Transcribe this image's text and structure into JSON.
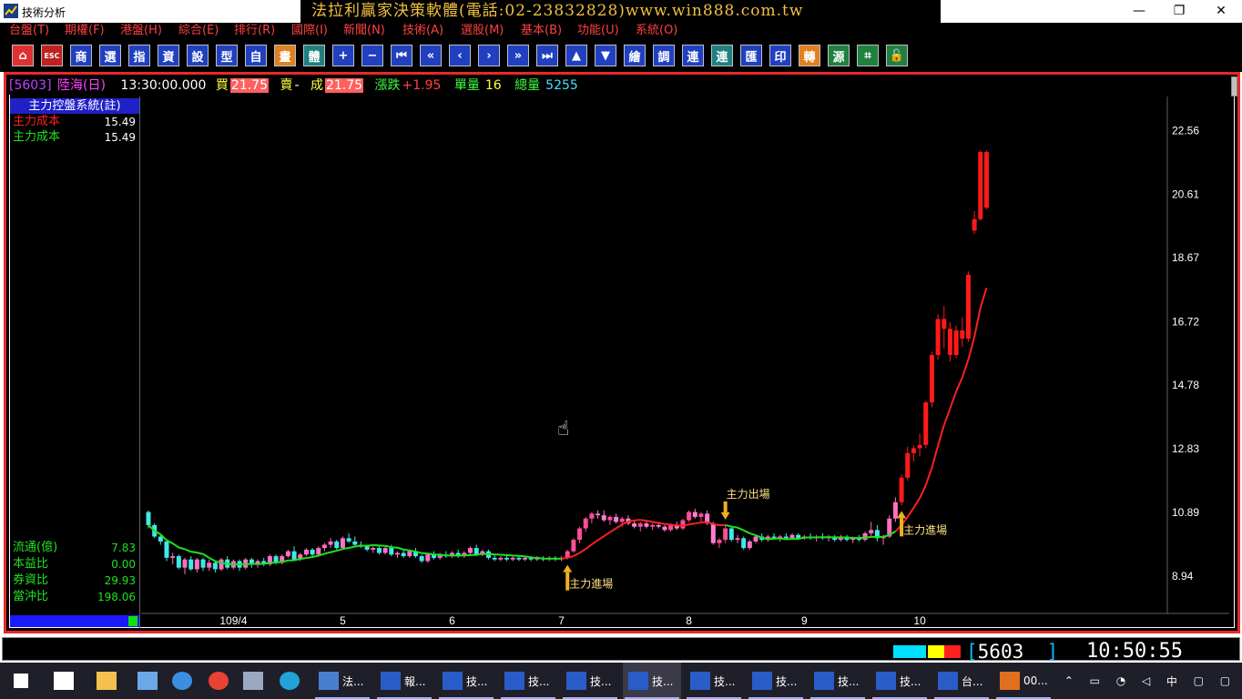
{
  "window": {
    "title": "技術分析",
    "banner": "法拉利贏家決策軟體(電話:02-23832828)www.win888.com.tw",
    "minimize": "—",
    "restore": "❐",
    "close": "✕"
  },
  "menu": [
    "台盤(T)",
    "期權(F)",
    "港盤(H)",
    "綜合(E)",
    "排行(R)",
    "國際(I)",
    "新聞(N)",
    "技術(A)",
    "選股(M)",
    "基本(B)",
    "功能(U)",
    "系統(O)"
  ],
  "toolbar": [
    {
      "name": "home-button",
      "glyph": "⌂",
      "bg": "#e03030"
    },
    {
      "name": "esc-button",
      "glyph": "ESC",
      "bg": "#c02020"
    },
    {
      "name": "shang-button",
      "glyph": "商",
      "bg": "#2040c0"
    },
    {
      "name": "tool-button-4",
      "glyph": "選",
      "bg": "#2040c0"
    },
    {
      "name": "tool-button-5",
      "glyph": "指",
      "bg": "#2040c0"
    },
    {
      "name": "zi-button",
      "glyph": "資",
      "bg": "#2040c0"
    },
    {
      "name": "tool-button-7",
      "glyph": "設",
      "bg": "#2040c0"
    },
    {
      "name": "tool-button-8",
      "glyph": "型",
      "bg": "#2040c0"
    },
    {
      "name": "zi-self-button",
      "glyph": "自",
      "bg": "#2040c0"
    },
    {
      "name": "tool-button-10",
      "glyph": "畫",
      "bg": "#e08020"
    },
    {
      "name": "tool-button-11",
      "glyph": "體",
      "bg": "#208080"
    },
    {
      "name": "plus-button",
      "glyph": "+",
      "bg": "#2040c0"
    },
    {
      "name": "minus-button",
      "glyph": "−",
      "bg": "#2040c0"
    },
    {
      "name": "first-button",
      "glyph": "⏮",
      "bg": "#2040c0"
    },
    {
      "name": "fast-back-button",
      "glyph": "«",
      "bg": "#2040c0"
    },
    {
      "name": "back-button",
      "glyph": "‹",
      "bg": "#2040c0"
    },
    {
      "name": "forward-button",
      "glyph": "›",
      "bg": "#2040c0"
    },
    {
      "name": "fast-forward-button",
      "glyph": "»",
      "bg": "#2040c0"
    },
    {
      "name": "last-button",
      "glyph": "⏭",
      "bg": "#2040c0"
    },
    {
      "name": "up-button",
      "glyph": "▲",
      "bg": "#2040c0"
    },
    {
      "name": "down-button",
      "glyph": "▼",
      "bg": "#2040c0"
    },
    {
      "name": "tool-button-22",
      "glyph": "繪",
      "bg": "#2040c0"
    },
    {
      "name": "tool-button-23",
      "glyph": "調",
      "bg": "#2040c0"
    },
    {
      "name": "lian-button",
      "glyph": "連",
      "bg": "#2040c0"
    },
    {
      "name": "lian2-button",
      "glyph": "連",
      "bg": "#208080"
    },
    {
      "name": "hui-button",
      "glyph": "匯",
      "bg": "#2040c0"
    },
    {
      "name": "print-button",
      "glyph": "印",
      "bg": "#2040c0"
    },
    {
      "name": "tool-button-28",
      "glyph": "轉",
      "bg": "#e08020"
    },
    {
      "name": "tool-button-29",
      "glyph": "源",
      "bg": "#208040"
    },
    {
      "name": "tool-button-30",
      "glyph": "⌗",
      "bg": "#208040"
    },
    {
      "name": "lock-button",
      "glyph": "🔓",
      "bg": "#208040"
    }
  ],
  "quote": {
    "code": "[5603]",
    "name": "陸海(日)",
    "time": "13:30:00.000",
    "buy_label": "買",
    "buy": "21.75",
    "sell_label": "賣",
    "sell": "-",
    "deal_label": "成",
    "deal": "21.75",
    "change_label": "漲跌",
    "change": "+1.95",
    "vol_label": "單量",
    "vol": "16",
    "total_label": "總量",
    "total": "5255"
  },
  "panel": {
    "title": "主力控盤系統(註)",
    "rows_top": [
      {
        "label": "主力成本",
        "value": "15.49",
        "color": "#ff2020"
      },
      {
        "label": "主力成本",
        "value": "15.49",
        "color": "#20e020"
      }
    ],
    "rows_bottom": [
      {
        "label": "流通(億)",
        "value": "7.83"
      },
      {
        "label": "本益比",
        "value": "0.00"
      },
      {
        "label": "券資比",
        "value": "29.93"
      },
      {
        "label": "當沖比",
        "value": "198.06"
      }
    ]
  },
  "chart_data": {
    "type": "candlestick",
    "y_ticks": [
      "22.56",
      "20.61",
      "18.67",
      "16.72",
      "14.78",
      "12.83",
      "10.89",
      "8.94"
    ],
    "ylim": [
      7.8,
      23.6
    ],
    "x_ticks": [
      "109/4",
      "5",
      "6",
      "7",
      "8",
      "9",
      "10"
    ],
    "candles": [
      [
        10.9,
        10.95,
        10.4,
        10.5
      ],
      [
        10.5,
        10.55,
        10.1,
        10.15
      ],
      [
        10.15,
        10.2,
        9.9,
        10.0
      ],
      [
        10.0,
        10.05,
        9.4,
        9.5
      ],
      [
        9.5,
        9.65,
        9.3,
        9.55
      ],
      [
        9.55,
        9.6,
        9.15,
        9.2
      ],
      [
        9.2,
        9.5,
        9.0,
        9.45
      ],
      [
        9.45,
        9.55,
        9.1,
        9.15
      ],
      [
        9.15,
        9.5,
        9.05,
        9.45
      ],
      [
        9.45,
        9.5,
        9.1,
        9.2
      ],
      [
        9.2,
        9.45,
        9.1,
        9.35
      ],
      [
        9.35,
        9.4,
        9.05,
        9.15
      ],
      [
        9.15,
        9.5,
        9.1,
        9.45
      ],
      [
        9.45,
        9.55,
        9.15,
        9.2
      ],
      [
        9.2,
        9.45,
        9.15,
        9.4
      ],
      [
        9.4,
        9.45,
        9.1,
        9.2
      ],
      [
        9.2,
        9.5,
        9.15,
        9.45
      ],
      [
        9.45,
        9.5,
        9.2,
        9.3
      ],
      [
        9.3,
        9.45,
        9.2,
        9.4
      ],
      [
        9.4,
        9.5,
        9.25,
        9.3
      ],
      [
        9.3,
        9.6,
        9.25,
        9.55
      ],
      [
        9.55,
        9.6,
        9.3,
        9.35
      ],
      [
        9.35,
        9.6,
        9.3,
        9.55
      ],
      [
        9.55,
        9.75,
        9.5,
        9.7
      ],
      [
        9.7,
        9.85,
        9.4,
        9.45
      ],
      [
        9.45,
        9.65,
        9.4,
        9.6
      ],
      [
        9.6,
        9.8,
        9.55,
        9.75
      ],
      [
        9.75,
        9.8,
        9.55,
        9.6
      ],
      [
        9.6,
        9.85,
        9.55,
        9.8
      ],
      [
        9.8,
        9.95,
        9.7,
        9.9
      ],
      [
        9.9,
        10.1,
        9.8,
        10.0
      ],
      [
        10.0,
        10.05,
        9.75,
        9.8
      ],
      [
        9.8,
        10.15,
        9.75,
        10.1
      ],
      [
        10.1,
        10.25,
        9.95,
        10.0
      ],
      [
        10.0,
        10.15,
        9.85,
        9.9
      ],
      [
        9.9,
        10.0,
        9.8,
        9.85
      ],
      [
        9.85,
        9.9,
        9.7,
        9.75
      ],
      [
        9.75,
        9.85,
        9.65,
        9.8
      ],
      [
        9.8,
        9.85,
        9.6,
        9.65
      ],
      [
        9.65,
        9.85,
        9.6,
        9.8
      ],
      [
        9.8,
        9.9,
        9.55,
        9.6
      ],
      [
        9.6,
        9.7,
        9.5,
        9.65
      ],
      [
        9.65,
        9.75,
        9.5,
        9.55
      ],
      [
        9.55,
        9.75,
        9.5,
        9.7
      ],
      [
        9.7,
        9.8,
        9.5,
        9.55
      ],
      [
        9.55,
        9.6,
        9.35,
        9.4
      ],
      [
        9.4,
        9.65,
        9.35,
        9.6
      ],
      [
        9.6,
        9.7,
        9.45,
        9.5
      ],
      [
        9.5,
        9.65,
        9.45,
        9.6
      ],
      [
        9.6,
        9.7,
        9.5,
        9.55
      ],
      [
        9.55,
        9.7,
        9.5,
        9.65
      ],
      [
        9.65,
        9.75,
        9.5,
        9.55
      ],
      [
        9.55,
        9.7,
        9.5,
        9.65
      ],
      [
        9.65,
        9.85,
        9.6,
        9.8
      ],
      [
        9.8,
        9.9,
        9.55,
        9.6
      ],
      [
        9.6,
        9.75,
        9.55,
        9.7
      ],
      [
        9.7,
        9.75,
        9.45,
        9.5
      ],
      [
        9.5,
        9.6,
        9.4,
        9.45
      ],
      [
        9.45,
        9.55,
        9.4,
        9.5
      ],
      [
        9.5,
        9.6,
        9.4,
        9.45
      ],
      [
        9.45,
        9.55,
        9.4,
        9.5
      ],
      [
        9.5,
        9.55,
        9.4,
        9.45
      ],
      [
        9.45,
        9.55,
        9.4,
        9.5
      ],
      [
        9.5,
        9.55,
        9.4,
        9.45
      ],
      [
        9.45,
        9.55,
        9.4,
        9.5
      ],
      [
        9.5,
        9.55,
        9.4,
        9.45
      ],
      [
        9.45,
        9.55,
        9.4,
        9.5
      ],
      [
        9.5,
        9.55,
        9.4,
        9.45
      ],
      [
        9.45,
        9.55,
        9.4,
        9.5
      ],
      [
        9.5,
        9.75,
        9.45,
        9.7
      ],
      [
        9.7,
        10.1,
        9.65,
        10.05
      ],
      [
        10.05,
        10.45,
        9.95,
        10.4
      ],
      [
        10.4,
        10.75,
        10.3,
        10.7
      ],
      [
        10.7,
        10.9,
        10.55,
        10.85
      ],
      [
        10.85,
        10.95,
        10.7,
        10.8
      ],
      [
        10.8,
        10.95,
        10.6,
        10.65
      ],
      [
        10.65,
        10.8,
        10.5,
        10.75
      ],
      [
        10.75,
        10.85,
        10.55,
        10.6
      ],
      [
        10.6,
        10.75,
        10.45,
        10.7
      ],
      [
        10.7,
        10.8,
        10.5,
        10.55
      ],
      [
        10.55,
        10.65,
        10.4,
        10.45
      ],
      [
        10.45,
        10.6,
        10.3,
        10.55
      ],
      [
        10.55,
        10.65,
        10.4,
        10.45
      ],
      [
        10.45,
        10.55,
        10.35,
        10.5
      ],
      [
        10.5,
        10.6,
        10.4,
        10.45
      ],
      [
        10.45,
        10.5,
        10.3,
        10.35
      ],
      [
        10.35,
        10.55,
        10.3,
        10.5
      ],
      [
        10.5,
        10.6,
        10.35,
        10.4
      ],
      [
        10.4,
        10.7,
        10.35,
        10.65
      ],
      [
        10.65,
        10.95,
        10.6,
        10.9
      ],
      [
        10.9,
        11.0,
        10.7,
        10.75
      ],
      [
        10.75,
        10.9,
        10.6,
        10.85
      ],
      [
        10.85,
        10.95,
        10.5,
        10.55
      ],
      [
        10.55,
        10.6,
        9.9,
        9.95
      ],
      [
        9.95,
        10.1,
        9.8,
        10.05
      ],
      [
        10.05,
        10.5,
        9.95,
        10.4
      ],
      [
        10.4,
        10.45,
        10.0,
        10.05
      ],
      [
        10.05,
        10.2,
        9.95,
        10.1
      ],
      [
        10.1,
        10.15,
        9.75,
        9.8
      ],
      [
        9.8,
        10.05,
        9.75,
        10.0
      ],
      [
        10.0,
        10.2,
        9.95,
        10.15
      ],
      [
        10.15,
        10.25,
        10.0,
        10.05
      ],
      [
        10.05,
        10.2,
        10.0,
        10.15
      ],
      [
        10.15,
        10.25,
        10.05,
        10.1
      ],
      [
        10.1,
        10.2,
        10.0,
        10.15
      ],
      [
        10.15,
        10.25,
        10.05,
        10.1
      ],
      [
        10.1,
        10.25,
        10.05,
        10.2
      ],
      [
        10.2,
        10.25,
        10.05,
        10.1
      ],
      [
        10.1,
        10.2,
        10.05,
        10.15
      ],
      [
        10.15,
        10.25,
        10.05,
        10.1
      ],
      [
        10.1,
        10.2,
        10.0,
        10.15
      ],
      [
        10.15,
        10.25,
        10.05,
        10.1
      ],
      [
        10.1,
        10.2,
        10.0,
        10.15
      ],
      [
        10.15,
        10.2,
        10.0,
        10.05
      ],
      [
        10.05,
        10.2,
        10.0,
        10.15
      ],
      [
        10.15,
        10.2,
        10.0,
        10.05
      ],
      [
        10.05,
        10.15,
        9.95,
        10.1
      ],
      [
        10.1,
        10.2,
        10.0,
        10.05
      ],
      [
        10.05,
        10.3,
        10.0,
        10.25
      ],
      [
        10.25,
        10.6,
        10.15,
        10.35
      ],
      [
        10.35,
        10.5,
        10.0,
        10.1
      ],
      [
        10.1,
        10.2,
        9.9,
        10.15
      ],
      [
        10.15,
        10.8,
        10.1,
        10.7
      ],
      [
        10.7,
        11.35,
        10.6,
        11.2
      ],
      [
        11.2,
        12.05,
        11.1,
        11.95
      ],
      [
        11.95,
        12.9,
        11.85,
        12.7
      ],
      [
        12.7,
        12.95,
        12.45,
        12.85
      ],
      [
        12.85,
        13.3,
        12.6,
        12.95
      ],
      [
        12.95,
        14.3,
        12.85,
        14.25
      ],
      [
        14.25,
        15.8,
        14.1,
        15.7
      ],
      [
        15.7,
        16.95,
        15.55,
        16.8
      ],
      [
        16.8,
        17.2,
        15.9,
        16.5
      ],
      [
        16.5,
        16.7,
        15.5,
        15.7
      ],
      [
        15.7,
        16.6,
        15.6,
        16.45
      ],
      [
        16.45,
        16.85,
        15.95,
        16.2
      ],
      [
        16.2,
        18.25,
        16.1,
        18.15
      ],
      [
        19.5,
        20.1,
        19.4,
        19.85
      ],
      [
        19.85,
        21.95,
        19.8,
        21.9
      ],
      [
        21.9,
        21.95,
        20.15,
        20.2
      ]
    ],
    "series": [
      {
        "name": "主力成本",
        "color": "#ff2020"
      },
      {
        "name": "主力成本",
        "color": "#20e020"
      }
    ],
    "annotations": [
      {
        "text": "主力進場",
        "candle": 69,
        "dir": "up"
      },
      {
        "text": "主力出場",
        "candle": 95,
        "dir": "down"
      },
      {
        "text": "主力進場",
        "candle": 124,
        "dir": "up"
      }
    ]
  },
  "status": {
    "code": "5603",
    "time": "10:50:55",
    "swatches": [
      "#00e0ff",
      "#00e0ff",
      "#ffff00",
      "#ff2020"
    ]
  },
  "taskbar": {
    "items": [
      {
        "name": "taskbar-start",
        "label": "",
        "icon": "windows-icon",
        "active": false
      },
      {
        "name": "taskbar-taskview",
        "label": "",
        "icon": "taskview-icon",
        "active": false
      },
      {
        "name": "taskbar-explorer",
        "label": "",
        "icon": "folder-icon",
        "active": false
      },
      {
        "name": "taskbar-app-1",
        "label": "",
        "icon": "computer-icon",
        "active": false
      },
      {
        "name": "taskbar-ie",
        "label": "",
        "icon": "ie-icon",
        "active": false
      },
      {
        "name": "taskbar-chrome",
        "label": "",
        "icon": "chrome-icon",
        "active": false
      },
      {
        "name": "taskbar-app-2",
        "label": "",
        "icon": "tool-icon",
        "active": false
      },
      {
        "name": "taskbar-edge",
        "label": "",
        "icon": "edge-icon",
        "active": false
      },
      {
        "name": "taskbar-app-3",
        "label": "法...",
        "icon": "app-icon",
        "active": false
      },
      {
        "name": "taskbar-app-4",
        "label": "報...",
        "icon": "chart-icon",
        "active": false
      },
      {
        "name": "taskbar-app-5",
        "label": "技...",
        "icon": "chart-icon",
        "active": false
      },
      {
        "name": "taskbar-app-6",
        "label": "技...",
        "icon": "chart-icon",
        "active": false
      },
      {
        "name": "taskbar-app-7",
        "label": "技...",
        "icon": "chart-icon",
        "active": false
      },
      {
        "name": "taskbar-app-8",
        "label": "技...",
        "icon": "chart-icon",
        "active": true
      },
      {
        "name": "taskbar-app-9",
        "label": "技...",
        "icon": "chart-icon",
        "active": false
      },
      {
        "name": "taskbar-app-10",
        "label": "技...",
        "icon": "chart-icon",
        "active": false
      },
      {
        "name": "taskbar-app-11",
        "label": "技...",
        "icon": "chart-icon",
        "active": false
      },
      {
        "name": "taskbar-app-12",
        "label": "技...",
        "icon": "chart-icon",
        "active": false
      },
      {
        "name": "taskbar-app-13",
        "label": "台...",
        "icon": "chart-icon",
        "active": false
      },
      {
        "name": "taskbar-app-14",
        "label": "00...",
        "icon": "office-icon",
        "active": false
      }
    ],
    "tray_lang": "中"
  }
}
